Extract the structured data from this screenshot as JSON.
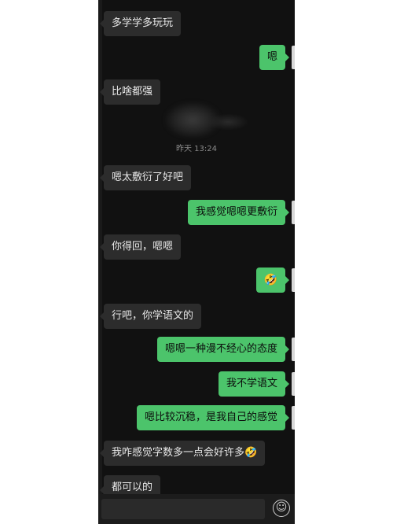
{
  "chat": {
    "timestamp": "昨天 13:24",
    "messages": [
      {
        "side": "left",
        "text": "多学学多玩玩"
      },
      {
        "side": "right",
        "text": "嗯"
      },
      {
        "side": "left",
        "text": "比啥都强"
      },
      {
        "side": "left",
        "text": "嗯太敷衍了好吧"
      },
      {
        "side": "right",
        "text": "我感觉嗯嗯更敷衍"
      },
      {
        "side": "left",
        "text": "你得回，嗯嗯"
      },
      {
        "side": "right",
        "text": "🤣"
      },
      {
        "side": "left",
        "text": "行吧，你学语文的"
      },
      {
        "side": "right",
        "text": "嗯嗯一种漫不经心的态度"
      },
      {
        "side": "right",
        "text": "我不学语文"
      },
      {
        "side": "right",
        "text": "嗯比较沉稳，是我自己的感觉"
      },
      {
        "side": "left",
        "text": "我咋感觉字数多一点会好许多🤣"
      },
      {
        "side": "left",
        "text": "都可以的"
      }
    ]
  },
  "input": {
    "emoji_icon": "emoji-smile-icon",
    "emoji_glyph": "☺"
  },
  "colors": {
    "background": "#111111",
    "incoming_bubble": "#2c2c2c",
    "outgoing_bubble": "#4cc46b"
  }
}
